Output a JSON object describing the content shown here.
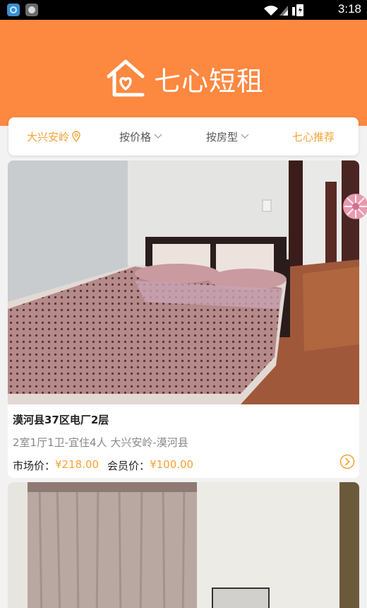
{
  "status_bar": {
    "time": "3:18"
  },
  "header": {
    "app_title": "七心短租"
  },
  "filters": {
    "location": "大兴安岭",
    "price": "按价格",
    "room_type": "按房型",
    "recommend": "七心推荐"
  },
  "listings": [
    {
      "title": "漠河县37区电厂2层",
      "subtitle": "2室1厅1卫-宜住4人 大兴安岭-漠河县",
      "market_label": "市场价：",
      "market_price": "¥218.00",
      "member_label": "会员价：",
      "member_price": "¥100.00"
    }
  ],
  "colors": {
    "brand": "#fd8840",
    "accent": "#f7a132"
  }
}
